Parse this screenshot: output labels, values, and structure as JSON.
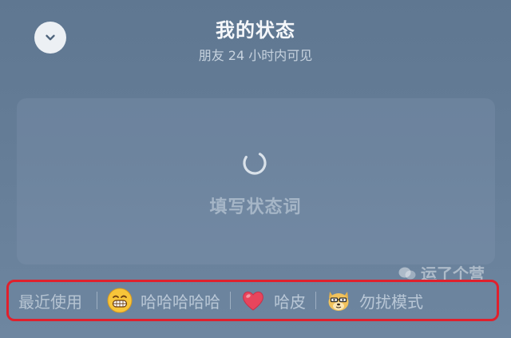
{
  "header": {
    "title": "我的状态",
    "subtitle": "朋友 24 小时内可见"
  },
  "status_input": {
    "placeholder": "填写状态词"
  },
  "recent": {
    "label": "最近使用",
    "items": [
      {
        "label": "哈哈哈哈哈",
        "icon": "grinning-face-icon"
      },
      {
        "label": "哈皮",
        "icon": "heart-icon"
      },
      {
        "label": "勿扰模式",
        "icon": "doge-icon"
      }
    ]
  },
  "watermark": {
    "text": "运了个营"
  },
  "colors": {
    "background": "#647c96",
    "highlight_border": "#e0202c",
    "heart": "#e8455c"
  }
}
